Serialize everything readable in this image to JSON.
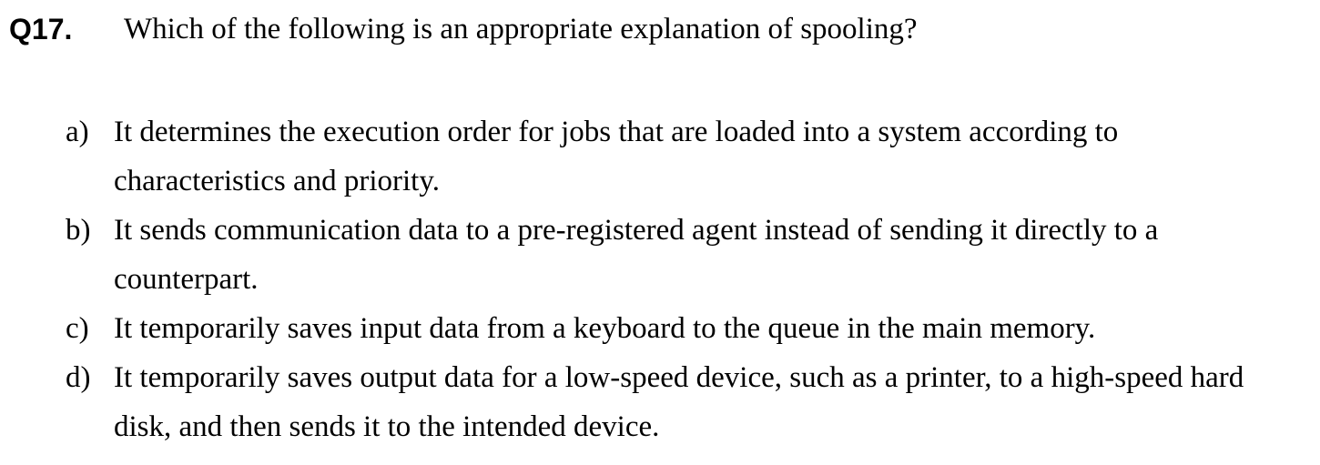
{
  "question": {
    "number": "Q17.",
    "text": "Which of the following is an appropriate explanation of spooling?"
  },
  "options": [
    {
      "letter": "a)",
      "text": "It determines the execution order for jobs that are loaded into a system according to characteristics and priority."
    },
    {
      "letter": "b)",
      "text": "It sends communication data to a pre-registered agent instead of sending it directly to a counterpart."
    },
    {
      "letter": "c)",
      "text": "It temporarily saves input data from a keyboard to the queue in the main memory."
    },
    {
      "letter": "d)",
      "text": "It temporarily saves output data for a low-speed device, such as a printer, to a high-speed hard disk, and then sends it to the intended device."
    }
  ]
}
